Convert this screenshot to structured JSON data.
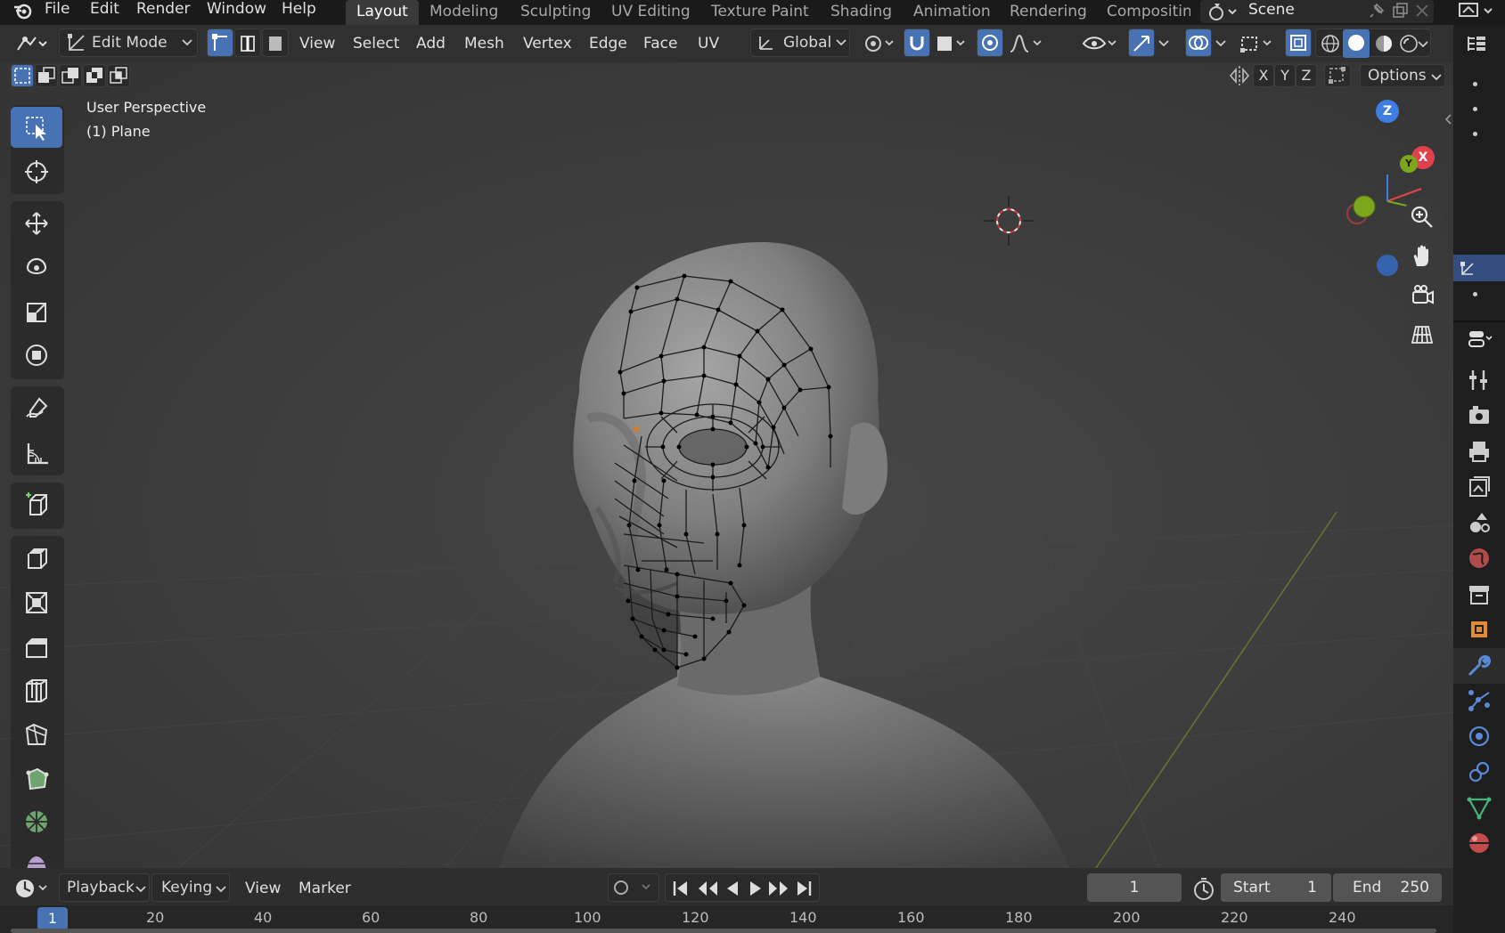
{
  "menu": {
    "file": "File",
    "edit": "Edit",
    "render": "Render",
    "window": "Window",
    "help": "Help"
  },
  "workspaces": [
    "Layout",
    "Modeling",
    "Sculpting",
    "UV Editing",
    "Texture Paint",
    "Shading",
    "Animation",
    "Rendering",
    "Compositin"
  ],
  "scene": {
    "label": "Scene"
  },
  "header": {
    "mode": "Edit Mode",
    "view": "View",
    "select": "Select",
    "add": "Add",
    "mesh": "Mesh",
    "vertex": "Vertex",
    "edge": "Edge",
    "face": "Face",
    "uv": "UV",
    "orientation": "Global"
  },
  "subheader": {
    "x": "X",
    "y": "Y",
    "z": "Z",
    "options": "Options"
  },
  "viewport": {
    "perspective": "User Perspective",
    "object": "(1) Plane"
  },
  "gizmo": {
    "z": "Z",
    "x": "X",
    "y": "Y"
  },
  "timeline": {
    "playback": "Playback",
    "keying": "Keying",
    "view": "View",
    "marker": "Marker",
    "current_frame": "1",
    "start_label": "Start",
    "start_value": "1",
    "end_label": "End",
    "end_value": "250",
    "ruler": [
      "1",
      "20",
      "40",
      "60",
      "80",
      "100",
      "120",
      "140",
      "160",
      "180",
      "200",
      "220",
      "240"
    ]
  },
  "colors": {
    "accent": "#4772b3",
    "axis_x": "#e0424d",
    "axis_y": "#7ca61c",
    "axis_z": "#3d7ee0",
    "viewport_bg": "#3d3d3d"
  },
  "icons": {
    "toolbar": [
      "select-box-icon",
      "cursor-icon",
      "move-icon",
      "rotate-icon",
      "scale-icon",
      "transform-icon",
      "annotate-icon",
      "measure-icon",
      "add-cube-icon",
      "extrude-icon",
      "inset-icon",
      "bevel-icon",
      "loop-cut-icon",
      "knife-icon",
      "poly-build-icon",
      "spin-icon",
      "smooth-icon"
    ]
  }
}
